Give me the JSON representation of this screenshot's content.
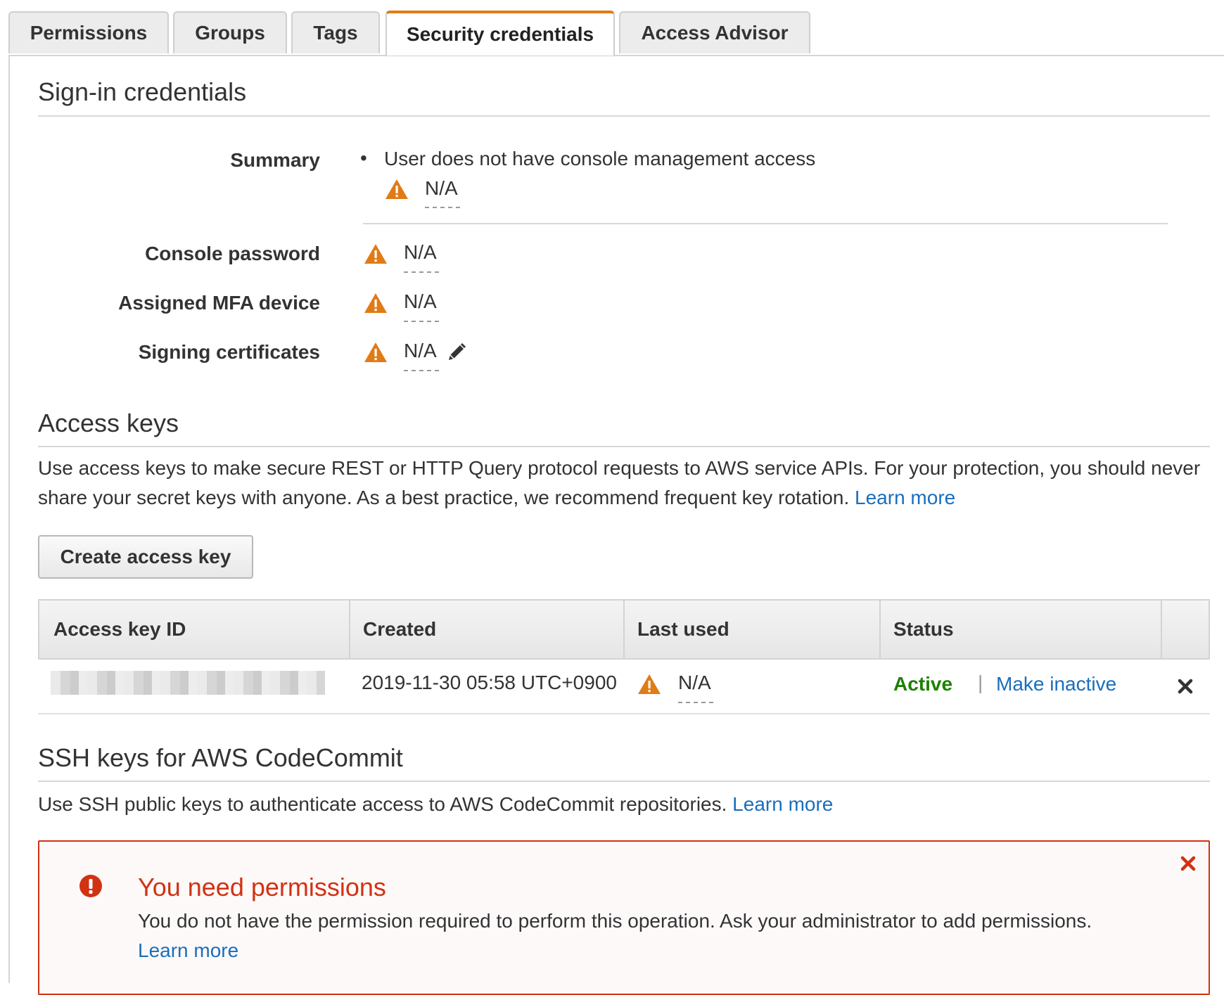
{
  "tabs": [
    {
      "label": "Permissions"
    },
    {
      "label": "Groups"
    },
    {
      "label": "Tags"
    },
    {
      "label": "Security credentials"
    },
    {
      "label": "Access Advisor"
    }
  ],
  "signin": {
    "title": "Sign-in credentials",
    "summary_label": "Summary",
    "summary_text": "User does not have console management access",
    "summary_value": "N/A",
    "console_password_label": "Console password",
    "console_password_value": "N/A",
    "mfa_label": "Assigned MFA device",
    "mfa_value": "N/A",
    "signing_label": "Signing certificates",
    "signing_value": "N/A"
  },
  "access_keys": {
    "title": "Access keys",
    "description": "Use access keys to make secure REST or HTTP Query protocol requests to AWS service APIs. For your protection, you should never share your secret keys with anyone. As a best practice, we recommend frequent key rotation.",
    "learn_more": "Learn more",
    "create_button": "Create access key",
    "columns": [
      "Access key ID",
      "Created",
      "Last used",
      "Status"
    ],
    "rows": [
      {
        "created": "2019-11-30 05:58 UTC+0900",
        "last_used": "N/A",
        "status": "Active",
        "action": "Make inactive"
      }
    ]
  },
  "ssh": {
    "title": "SSH keys for AWS CodeCommit",
    "description": "Use SSH public keys to authenticate access to AWS CodeCommit repositories.",
    "learn_more": "Learn more"
  },
  "alert": {
    "title": "You need permissions",
    "body": "You do not have the permission required to perform this operation. Ask your administrator to add permissions.",
    "learn_more": "Learn more"
  },
  "colors": {
    "accent": "#e07b16",
    "link": "#1a6ebd",
    "active": "#1d8102",
    "error": "#d13212"
  },
  "icons": [
    "warning-icon",
    "pencil-icon",
    "remove-icon",
    "error-icon",
    "close-icon"
  ]
}
